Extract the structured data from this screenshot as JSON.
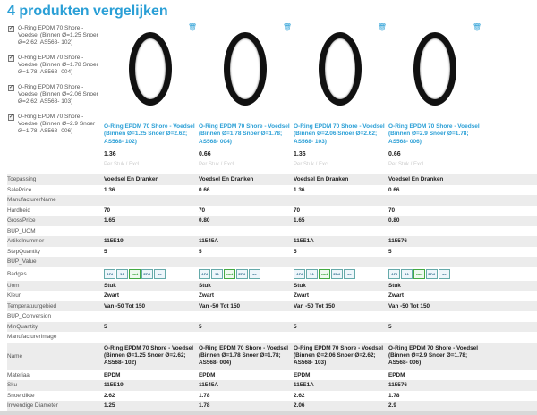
{
  "page_title": "4 produkten vergelijken",
  "selection": [
    {
      "label": "O-Ring EPDM 70 Shore - Voedsel (Binnen Ø=1.25 Snoer Ø=2.62; AS568- 102)"
    },
    {
      "label": "O-Ring EPDM 70 Shore - Voedsel (Binnen Ø=1.78 Snoer Ø=1.78; AS568- 004)"
    },
    {
      "label": "O-Ring EPDM 70 Shore - Voedsel (Binnen Ø=2.06 Snoer Ø=2.62; AS568- 103)"
    },
    {
      "label": "O-Ring EPDM 70 Shore - Voedsel (Binnen Ø=2.9 Snoer Ø=1.78; AS568- 006)"
    }
  ],
  "products": [
    {
      "name": "O-Ring EPDM 70 Shore - Voedsel (Binnen Ø=1.25 Snoer Ø=2.62; AS568- 102)",
      "price": "1.36",
      "unit": "Per Stuk / Excl."
    },
    {
      "name": "O-Ring EPDM 70 Shore - Voedsel (Binnen Ø=1.78 Snoer Ø=1.78; AS568- 004)",
      "price": "0.66",
      "unit": "Per Stuk / Excl."
    },
    {
      "name": "O-Ring EPDM 70 Shore - Voedsel (Binnen Ø=2.06 Snoer Ø=2.62; AS568- 103)",
      "price": "1.36",
      "unit": "Per Stuk / Excl."
    },
    {
      "name": "O-Ring EPDM 70 Shore - Voedsel (Binnen Ø=2.9 Snoer Ø=1.78; AS568- 006)",
      "price": "0.66",
      "unit": "Per Stuk / Excl."
    }
  ],
  "rows": [
    {
      "label": "Toepassing",
      "values": [
        "Voedsel En Dranken",
        "Voedsel En Dranken",
        "Voedsel En Dranken",
        "Voedsel En Dranken"
      ]
    },
    {
      "label": "SalePrice",
      "values": [
        "1.36",
        "0.66",
        "1.36",
        "0.66"
      ]
    },
    {
      "label": "ManufacturerName",
      "values": [
        "",
        "",
        "",
        ""
      ]
    },
    {
      "label": "Hardheid",
      "values": [
        "70",
        "70",
        "70",
        "70"
      ]
    },
    {
      "label": "GrossPrice",
      "values": [
        "1.65",
        "0.80",
        "1.65",
        "0.80"
      ]
    },
    {
      "label": "BUP_UOM",
      "values": [
        "",
        "",
        "",
        ""
      ]
    },
    {
      "label": "Artikelnummer",
      "values": [
        "115E19",
        "11545A",
        "115E1A",
        "115576"
      ]
    },
    {
      "label": "StepQuantity",
      "values": [
        "5",
        "5",
        "5",
        "5"
      ]
    },
    {
      "label": "BUP_Value",
      "values": [
        "",
        "",
        "",
        ""
      ]
    },
    {
      "label": "Badges",
      "values": [
        "",
        "",
        "",
        ""
      ]
    },
    {
      "label": "Uom",
      "values": [
        "Stuk",
        "Stuk",
        "Stuk",
        "Stuk"
      ]
    },
    {
      "label": "Kleur",
      "values": [
        "Zwart",
        "Zwart",
        "Zwart",
        "Zwart"
      ]
    },
    {
      "label": "Temperatuurgebied",
      "values": [
        "Van -50 Tot 150",
        "Van -50 Tot 150",
        "Van -50 Tot 150",
        "Van -50 Tot 150"
      ]
    },
    {
      "label": "BUP_Conversion",
      "values": [
        "",
        "",
        "",
        ""
      ]
    },
    {
      "label": "MinQuantity",
      "values": [
        "5",
        "5",
        "5",
        "5"
      ]
    },
    {
      "label": "ManufacturerImage",
      "values": [
        "",
        "",
        "",
        ""
      ]
    },
    {
      "label": "Name",
      "values": [
        "O-Ring EPDM 70 Shore - Voedsel (Binnen Ø=1.25 Snoer Ø=2.62; AS568- 102)",
        "O-Ring EPDM 70 Shore - Voedsel (Binnen Ø=1.78 Snoer Ø=1.78; AS568- 004)",
        "O-Ring EPDM 70 Shore - Voedsel (Binnen Ø=2.06 Snoer Ø=2.62; AS568- 103)",
        "O-Ring EPDM 70 Shore - Voedsel (Binnen Ø=2.9 Snoer Ø=1.78; AS568- 006)"
      ]
    },
    {
      "label": "Materiaal",
      "values": [
        "EPDM",
        "EPDM",
        "EPDM",
        "EPDM"
      ]
    },
    {
      "label": "Sku",
      "values": [
        "115E19",
        "11545A",
        "115E1A",
        "115576"
      ]
    },
    {
      "label": "Snoerdikte",
      "values": [
        "2.62",
        "1.78",
        "2.62",
        "1.78"
      ]
    },
    {
      "label": "Inwendige Diameter",
      "values": [
        "1.25",
        "1.78",
        "2.06",
        "2.9"
      ]
    }
  ],
  "badge_icons": [
    "ADI",
    "3A",
    "cert",
    "FDA",
    "ec"
  ],
  "icons": {
    "checkbox": "checkbox-icon",
    "trash": "trash-icon"
  },
  "colors": {
    "accent": "#2a9fd6",
    "stripe": "#ececec"
  }
}
